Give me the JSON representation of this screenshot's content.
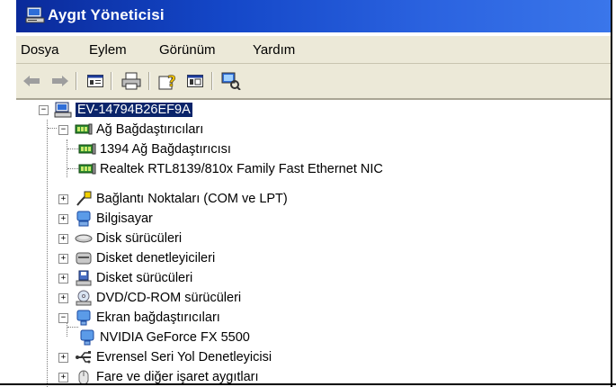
{
  "window": {
    "title": "Aygıt Yöneticisi"
  },
  "menubar": {
    "items": [
      "Dosya",
      "Eylem",
      "Görünüm",
      "Yardım"
    ]
  },
  "toolbar": {
    "buttons": [
      "back-icon",
      "forward-icon",
      "properties-view-icon",
      "print-icon",
      "help-icon",
      "show-hide-icon",
      "scan-hardware-icon"
    ]
  },
  "tree": {
    "root": "EV-14794B26EF9A",
    "nodes": [
      {
        "label": "Ağ Bağdaştırıcıları",
        "icon": "network-icon",
        "expanded": true
      },
      {
        "label": "1394 Ağ Bağdaştırıcısı",
        "icon": "network-card-icon"
      },
      {
        "label": "Realtek RTL8139/810x Family Fast Ethernet NIC",
        "icon": "network-card-icon"
      },
      {
        "label": "Bağlantı Noktaları (COM ve LPT)",
        "icon": "port-icon",
        "expanded": false
      },
      {
        "label": "Bilgisayar",
        "icon": "computer-icon",
        "expanded": false
      },
      {
        "label": "Disk sürücüleri",
        "icon": "disk-icon",
        "expanded": false
      },
      {
        "label": "Disket denetleyicileri",
        "icon": "floppy-controller-icon",
        "expanded": false
      },
      {
        "label": "Disket sürücüleri",
        "icon": "floppy-drive-icon",
        "expanded": false
      },
      {
        "label": "DVD/CD-ROM sürücüleri",
        "icon": "cdrom-icon",
        "expanded": false
      },
      {
        "label": "Ekran bağdaştırıcıları",
        "icon": "display-icon",
        "expanded": true
      },
      {
        "label": "NVIDIA GeForce FX 5500",
        "icon": "display-adapter-icon"
      },
      {
        "label": "Evrensel Seri Yol Denetleyicisi",
        "icon": "usb-icon",
        "expanded": false
      },
      {
        "label": "Fare ve diğer işaret aygıtları",
        "icon": "mouse-icon",
        "expanded": false
      }
    ]
  }
}
